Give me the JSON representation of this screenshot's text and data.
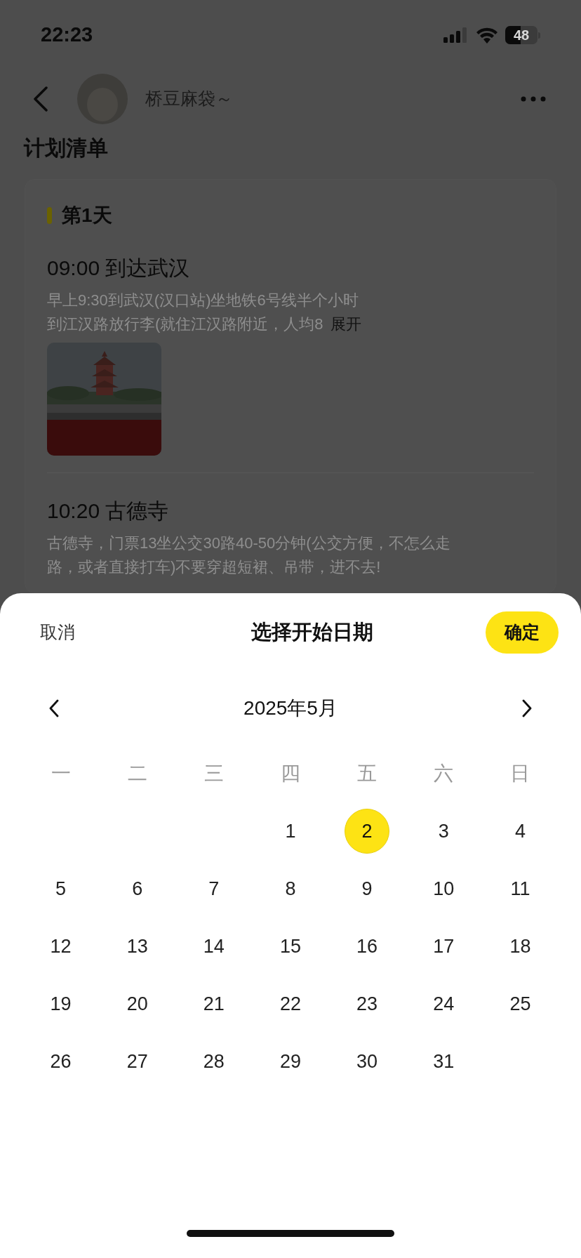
{
  "status_bar": {
    "time": "22:23",
    "battery": "48"
  },
  "header": {
    "user_name": "桥豆麻袋～",
    "title": "计划清单"
  },
  "plan": {
    "day_label": "第1天",
    "items": [
      {
        "title": "09:00 到达武汉",
        "lines": [
          "早上9:30到武汉(汉口站)坐地铁6号线半个小时",
          "到江汉路放行李(就住江汉路附近，人均8"
        ],
        "expand": "展开"
      },
      {
        "title": "10:20 古德寺",
        "lines": [
          "古德寺，门票13坐公交30路40-50分钟(公交方便，不怎么走",
          "路，或者直接打车)不要穿超短裙、吊带，进不去!"
        ]
      }
    ]
  },
  "date_sheet": {
    "cancel": "取消",
    "title": "选择开始日期",
    "confirm": "确定",
    "month": "2025年5月",
    "weekdays": [
      "一",
      "二",
      "三",
      "四",
      "五",
      "六",
      "日"
    ],
    "weeks": [
      [
        {
          "kind": "blank"
        },
        {
          "kind": "blank"
        },
        {
          "kind": "blank"
        },
        {
          "kind": "day",
          "label": "1",
          "selected": false
        },
        {
          "kind": "day",
          "label": "2",
          "selected": true
        },
        {
          "kind": "day",
          "label": "3",
          "selected": false
        },
        {
          "kind": "day",
          "label": "4",
          "selected": false
        }
      ],
      [
        {
          "kind": "day",
          "label": "5",
          "selected": false
        },
        {
          "kind": "day",
          "label": "6",
          "selected": false
        },
        {
          "kind": "day",
          "label": "7",
          "selected": false
        },
        {
          "kind": "day",
          "label": "8",
          "selected": false
        },
        {
          "kind": "day",
          "label": "9",
          "selected": false
        },
        {
          "kind": "day",
          "label": "10",
          "selected": false
        },
        {
          "kind": "day",
          "label": "11",
          "selected": false
        }
      ],
      [
        {
          "kind": "day",
          "label": "12",
          "selected": false
        },
        {
          "kind": "day",
          "label": "13",
          "selected": false
        },
        {
          "kind": "day",
          "label": "14",
          "selected": false
        },
        {
          "kind": "day",
          "label": "15",
          "selected": false
        },
        {
          "kind": "day",
          "label": "16",
          "selected": false
        },
        {
          "kind": "day",
          "label": "17",
          "selected": false
        },
        {
          "kind": "day",
          "label": "18",
          "selected": false
        }
      ],
      [
        {
          "kind": "day",
          "label": "19",
          "selected": false
        },
        {
          "kind": "day",
          "label": "20",
          "selected": false
        },
        {
          "kind": "day",
          "label": "21",
          "selected": false
        },
        {
          "kind": "day",
          "label": "22",
          "selected": false
        },
        {
          "kind": "day",
          "label": "23",
          "selected": false
        },
        {
          "kind": "day",
          "label": "24",
          "selected": false
        },
        {
          "kind": "day",
          "label": "25",
          "selected": false
        }
      ],
      [
        {
          "kind": "day",
          "label": "26",
          "selected": false
        },
        {
          "kind": "day",
          "label": "27",
          "selected": false
        },
        {
          "kind": "day",
          "label": "28",
          "selected": false
        },
        {
          "kind": "day",
          "label": "29",
          "selected": false
        },
        {
          "kind": "day",
          "label": "30",
          "selected": false
        },
        {
          "kind": "day",
          "label": "31",
          "selected": false
        },
        {
          "kind": "blank"
        }
      ]
    ]
  }
}
